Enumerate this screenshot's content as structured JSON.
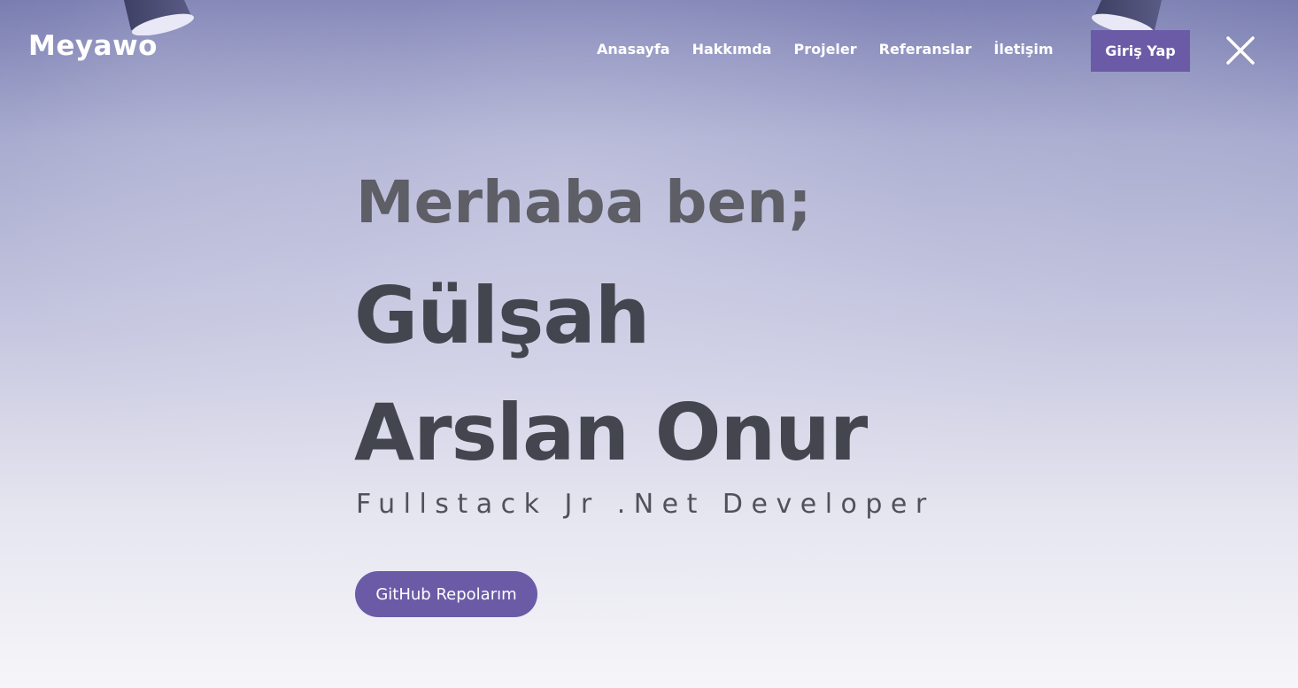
{
  "header": {
    "logo": "Meyawo",
    "nav": [
      {
        "label": "Anasayfa"
      },
      {
        "label": "Hakkımda"
      },
      {
        "label": "Projeler"
      },
      {
        "label": "Referanslar"
      },
      {
        "label": "İletişim"
      }
    ],
    "login_label": "Giriş Yap",
    "close_icon": "close-icon"
  },
  "hero": {
    "greeting": "Merhaba ben;",
    "name_line_1": "Gülşah",
    "name_line_2": "Arslan Onur",
    "role": "Fullstack Jr .Net Developer",
    "cta_label": "GitHub Repolarım"
  },
  "colors": {
    "accent": "#6b5ba7",
    "heading": "#44464f",
    "greeting": "#5d5e66",
    "nav_text": "#ffffff"
  }
}
